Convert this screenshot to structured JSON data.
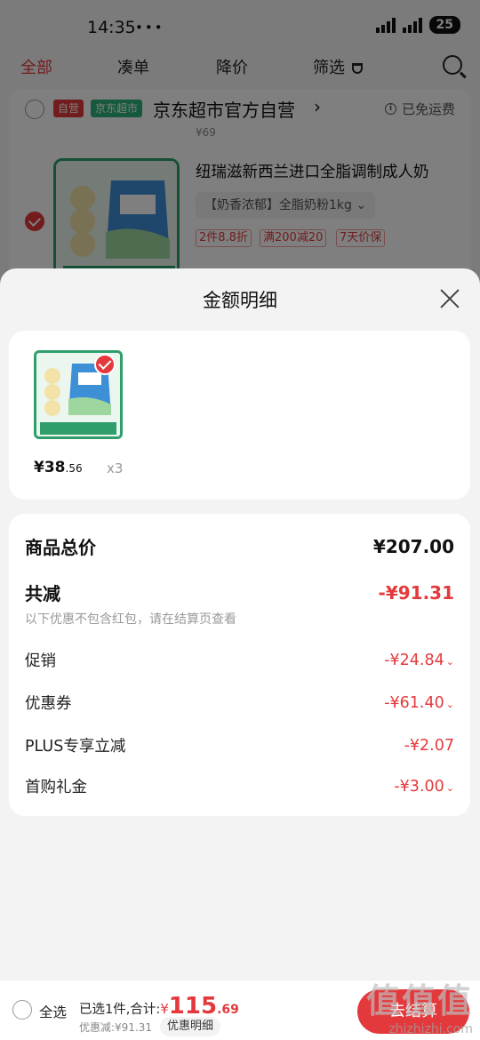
{
  "status_bar": {
    "time": "14:35",
    "extra_icons": "••• ",
    "battery": "25"
  },
  "tabs": [
    {
      "label": "全部",
      "active": true
    },
    {
      "label": "凑单"
    },
    {
      "label": "降价"
    },
    {
      "label": "筛选"
    }
  ],
  "shop": {
    "tag_self": "自营",
    "tag_market": "京东超市",
    "name": "京东超市官方自营",
    "free_shipping": "已免运费",
    "price_hint": "¥69"
  },
  "product": {
    "title": "纽瑞滋新西兰进口全脂调制成人奶",
    "spec": "【奶香浓郁】全脂奶粉1kg",
    "promos": [
      "2件8.8折",
      "满200减20",
      "7天价保"
    ]
  },
  "sheet": {
    "title": "金额明细",
    "item": {
      "price_int": "¥38",
      "price_dec": ".56",
      "qty": "x3"
    },
    "total_label": "商品总价",
    "total_value": "¥207.00",
    "reduce_label": "共减",
    "reduce_value": "-¥91.31",
    "note": "以下优惠不包含红包，请在结算页查看",
    "lines": [
      {
        "label": "促销",
        "value": "-¥24.84",
        "expandable": true
      },
      {
        "label": "优惠券",
        "value": "-¥61.40",
        "expandable": true
      },
      {
        "label": "PLUS专享立减",
        "value": "-¥2.07",
        "expandable": false
      },
      {
        "label": "首购礼金",
        "value": "-¥3.00",
        "expandable": true
      }
    ]
  },
  "checkout": {
    "select_all": "全选",
    "selected_prefix": "已选1件,合计:",
    "currency": "¥",
    "amount_int": "115",
    "amount_dec": ".69",
    "saved": "优惠减:¥91.31",
    "detail_pill": "优惠明细",
    "button": "去结算"
  },
  "watermark": {
    "big": "值值值",
    "small": "zhizhizhi.com"
  },
  "colors": {
    "accent": "#e4393c",
    "green": "#2db37a"
  }
}
